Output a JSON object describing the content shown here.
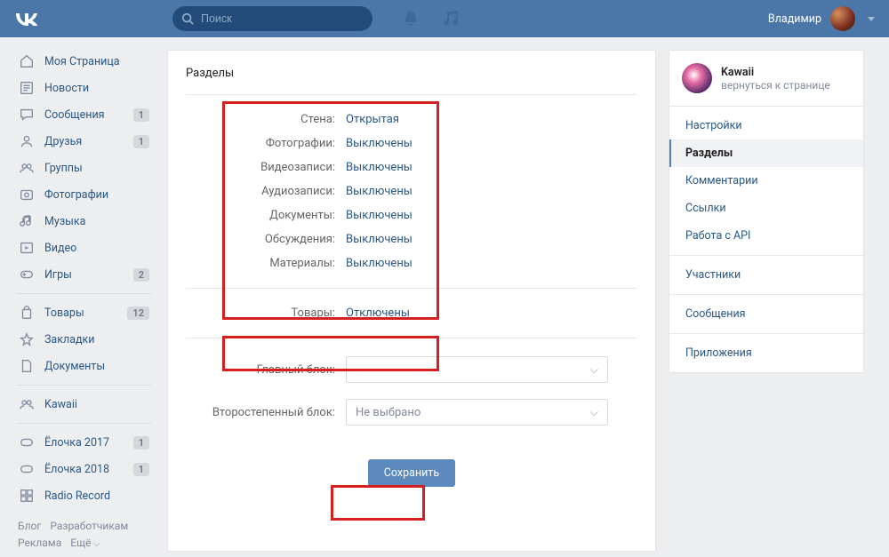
{
  "header": {
    "search_placeholder": "Поиск",
    "user_name": "Владимир"
  },
  "sidebar": {
    "items": [
      {
        "label": "Моя Страница",
        "icon": "home"
      },
      {
        "label": "Новости",
        "icon": "feed"
      },
      {
        "label": "Сообщения",
        "icon": "msg",
        "badge": "1"
      },
      {
        "label": "Друзья",
        "icon": "friend",
        "badge": "1"
      },
      {
        "label": "Группы",
        "icon": "group"
      },
      {
        "label": "Фотографии",
        "icon": "photo"
      },
      {
        "label": "Музыка",
        "icon": "music"
      },
      {
        "label": "Видео",
        "icon": "video"
      },
      {
        "label": "Игры",
        "icon": "game",
        "badge": "2"
      }
    ],
    "items2": [
      {
        "label": "Товары",
        "icon": "bag",
        "badge": "12"
      },
      {
        "label": "Закладки",
        "icon": "star"
      },
      {
        "label": "Документы",
        "icon": "doc"
      }
    ],
    "items3": [
      {
        "label": "Kawaii",
        "icon": "group"
      }
    ],
    "items4": [
      {
        "label": "Ёлочка 2017",
        "icon": "game2",
        "badge": "1"
      },
      {
        "label": "Ёлочка 2018",
        "icon": "game2",
        "badge": "1"
      },
      {
        "label": "Radio Record",
        "icon": "radio"
      }
    ],
    "footer": [
      "Блог",
      "Разработчикам",
      "Реклама",
      "Ещё"
    ]
  },
  "main": {
    "title": "Разделы",
    "settings": [
      {
        "label": "Стена:",
        "value": "Открытая"
      },
      {
        "label": "Фотографии:",
        "value": "Выключены"
      },
      {
        "label": "Видеозаписи:",
        "value": "Выключены"
      },
      {
        "label": "Аудиозаписи:",
        "value": "Выключены"
      },
      {
        "label": "Документы:",
        "value": "Выключены"
      },
      {
        "label": "Обсуждения:",
        "value": "Выключены"
      },
      {
        "label": "Материалы:",
        "value": "Выключены"
      }
    ],
    "goods": {
      "label": "Товары:",
      "value": "Отключены"
    },
    "main_block_label": "Главный блок:",
    "secondary_block_label": "Второстепенный блок:",
    "secondary_placeholder": "Не выбрано",
    "save_label": "Сохранить"
  },
  "right": {
    "group_name": "Kawaii",
    "group_back": "вернуться к странице",
    "nav1": [
      "Настройки",
      "Разделы",
      "Комментарии",
      "Ссылки",
      "Работа с API"
    ],
    "nav2": [
      "Участники"
    ],
    "nav3": [
      "Сообщения"
    ],
    "nav4": [
      "Приложения"
    ],
    "active": "Разделы"
  }
}
